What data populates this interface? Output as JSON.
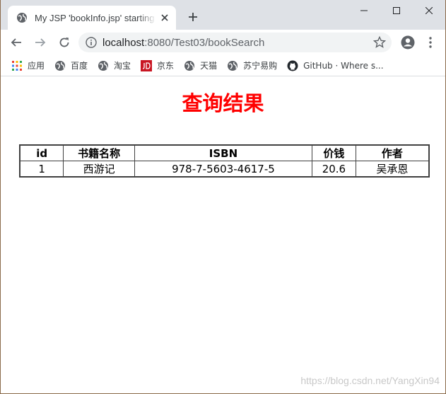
{
  "browser": {
    "tab_title": "My JSP 'bookInfo.jsp' starting page",
    "url_host": "localhost",
    "url_rest": ":8080/Test03/bookSearch"
  },
  "bookmarks": [
    {
      "label": "应用",
      "icon": "apps-grid-icon"
    },
    {
      "label": "百度",
      "icon": "globe-icon"
    },
    {
      "label": "淘宝",
      "icon": "globe-icon"
    },
    {
      "label": "京东",
      "icon": "jd-logo-icon"
    },
    {
      "label": "天猫",
      "icon": "globe-icon"
    },
    {
      "label": "苏宁易购",
      "icon": "globe-icon"
    },
    {
      "label": "GitHub · Where s...",
      "icon": "github-icon"
    }
  ],
  "page": {
    "title": "查询结果",
    "table": {
      "headers": [
        "id",
        "书籍名称",
        "ISBN",
        "价钱",
        "作者"
      ],
      "rows": [
        [
          "1",
          "西游记",
          "978-7-5603-4617-5",
          "20.6",
          "吴承恩"
        ]
      ]
    },
    "watermark": "https://blog.csdn.net/YangXin94"
  },
  "colors": {
    "title_red": "#ff0000",
    "tabstrip_bg": "#dee1e6",
    "omnibox_bg": "#f1f3f4"
  }
}
